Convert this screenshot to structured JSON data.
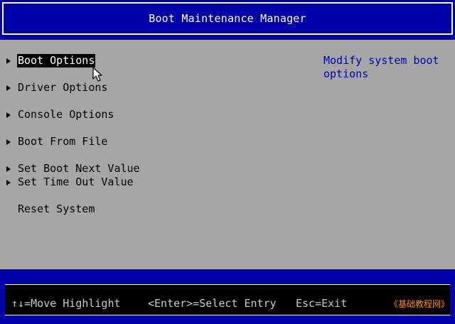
{
  "header": {
    "title": "Boot Maintenance Manager"
  },
  "menu": {
    "items": [
      {
        "label": "Boot Options",
        "has_arrow": true,
        "selected": true
      },
      {
        "label": "Driver Options",
        "has_arrow": true,
        "selected": false
      },
      {
        "label": "Console Options",
        "has_arrow": true,
        "selected": false
      },
      {
        "label": "Boot From File",
        "has_arrow": true,
        "selected": false
      },
      {
        "label": "Set Boot Next Value",
        "has_arrow": true,
        "selected": false
      },
      {
        "label": "Set Time Out Value",
        "has_arrow": true,
        "selected": false
      },
      {
        "label": "Reset System",
        "has_arrow": false,
        "selected": false
      }
    ]
  },
  "help": {
    "text": "Modify system boot options"
  },
  "footer": {
    "move_hint": "↑↓=Move Highlight",
    "select_hint": "<Enter>=Select Entry",
    "exit_hint": "Esc=Exit",
    "watermark": "《基础教程网》"
  },
  "colors": {
    "background": "#a6a6a6",
    "bar_blue": "#0000a8",
    "help_text": "#0000a8",
    "highlight_bg": "#000000",
    "watermark": "#ff8a1a"
  },
  "icons": {
    "submenu_arrow": "triangle-right-icon",
    "cursor": "mouse-pointer-icon"
  }
}
